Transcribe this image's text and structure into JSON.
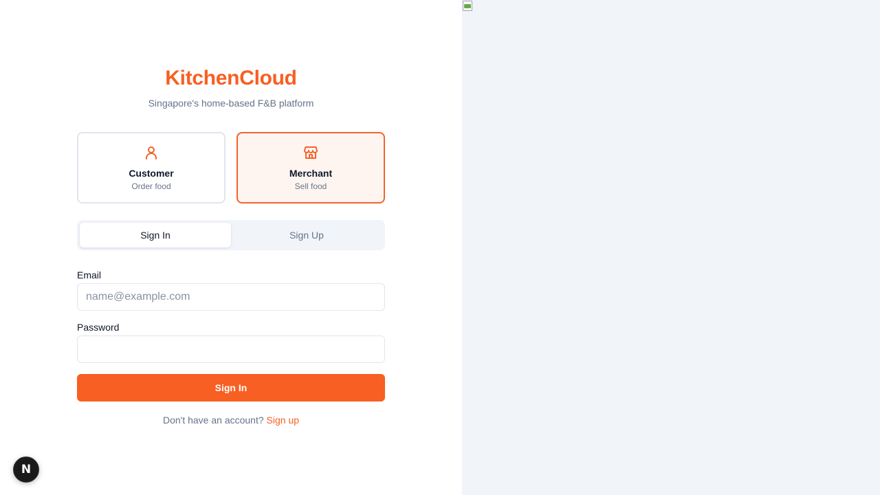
{
  "brand": {
    "name": "KitchenCloud",
    "tagline": "Singapore's home-based F&B platform",
    "accent_color": "#f85f22"
  },
  "roles": [
    {
      "name": "Customer",
      "subtitle": "Order food",
      "icon": "user-icon",
      "selected": false
    },
    {
      "name": "Merchant",
      "subtitle": "Sell food",
      "icon": "store-icon",
      "selected": true
    }
  ],
  "tabs": [
    {
      "label": "Sign In",
      "active": true
    },
    {
      "label": "Sign Up",
      "active": false
    }
  ],
  "form": {
    "email_label": "Email",
    "email_placeholder": "name@example.com",
    "email_value": "",
    "password_label": "Password",
    "password_value": "",
    "submit_label": "Sign In"
  },
  "footer": {
    "prompt": "Don't have an account?",
    "link": "Sign up"
  },
  "dev_badge": {
    "letter": "N",
    "icon": "nextjs-icon"
  },
  "side_panel": {
    "image_icon": "broken-image-icon",
    "background": "#f1f4f9"
  }
}
